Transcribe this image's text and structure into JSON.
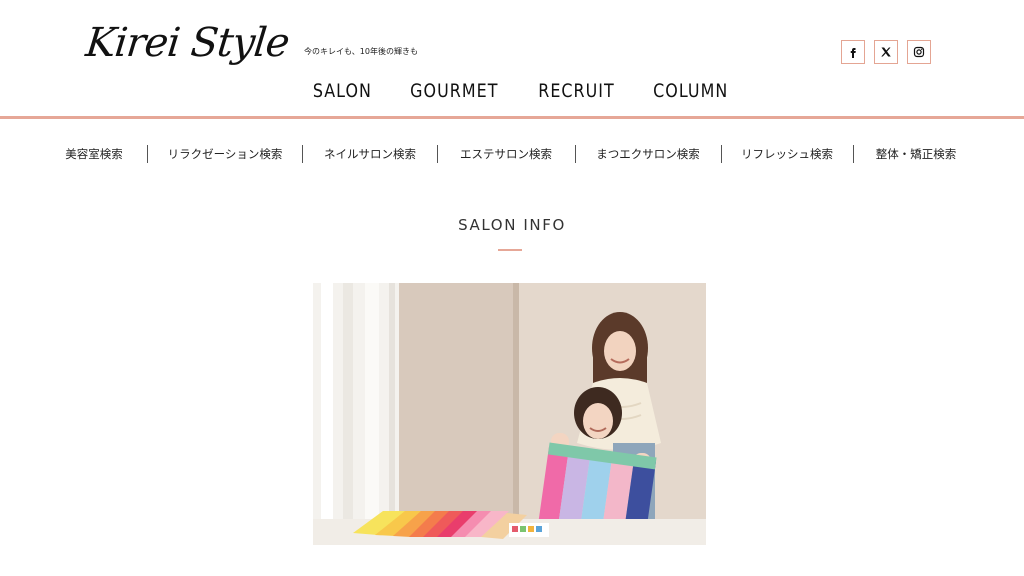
{
  "header": {
    "logo_text": "Kirei Style",
    "tagline": "今のキレイも、10年後の輝きも",
    "social": [
      {
        "name": "facebook-icon"
      },
      {
        "name": "x-icon"
      },
      {
        "name": "instagram-icon"
      }
    ],
    "nav": [
      {
        "label": "SALON"
      },
      {
        "label": "GOURMET"
      },
      {
        "label": "RECRUIT"
      },
      {
        "label": "COLUMN"
      }
    ]
  },
  "categories": [
    {
      "label": "美容室検索"
    },
    {
      "label": "リラクゼーション検索"
    },
    {
      "label": "ネイルサロン検索"
    },
    {
      "label": "エステサロン検索"
    },
    {
      "label": "まつエクサロン検索"
    },
    {
      "label": "リフレッシュ検索"
    },
    {
      "label": "整体・矯正検索"
    }
  ],
  "section": {
    "title": "SALON INFO"
  },
  "colors": {
    "accent": "#e6a797",
    "text": "#222222",
    "background": "#ffffff"
  }
}
